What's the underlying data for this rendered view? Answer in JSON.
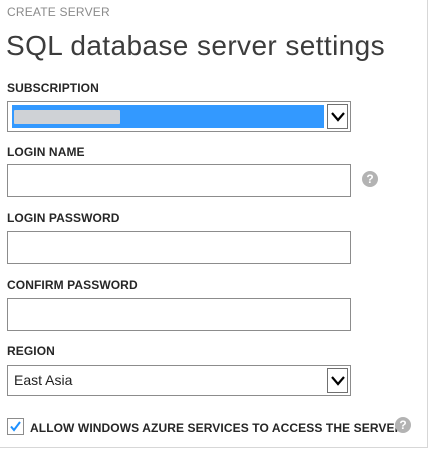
{
  "header": {
    "kicker": "CREATE SERVER",
    "title": "SQL database server settings"
  },
  "subscription": {
    "label": "SUBSCRIPTION",
    "selected_value": "",
    "value_redacted": true
  },
  "login_name": {
    "label": "LOGIN NAME",
    "value": "",
    "placeholder": ""
  },
  "login_password": {
    "label": "LOGIN PASSWORD",
    "value": "",
    "placeholder": ""
  },
  "confirm_password": {
    "label": "CONFIRM PASSWORD",
    "value": "",
    "placeholder": ""
  },
  "region": {
    "label": "REGION",
    "selected_value": "East Asia"
  },
  "allow_azure_services": {
    "label": "ALLOW WINDOWS AZURE SERVICES TO ACCESS THE SERVER.",
    "checked": true
  },
  "help_icon_glyph": "?",
  "colors": {
    "selection_highlight": "#3399ff",
    "checkmark": "#1e90ff",
    "help_icon": "#b3b3b3",
    "title_text": "#3c3c3c",
    "kicker_text": "#8a8a8a"
  },
  "icons": {
    "dropdown": "chevron-down-icon",
    "help": "help-icon",
    "check": "checkmark-icon"
  }
}
